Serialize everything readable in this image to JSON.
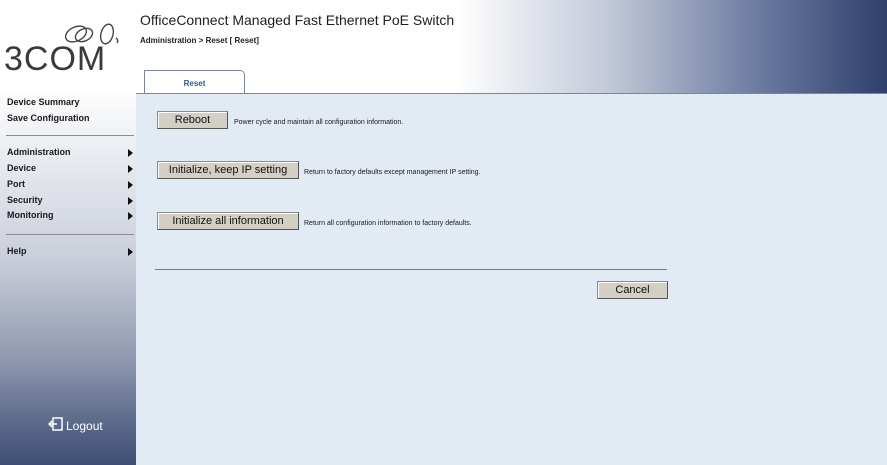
{
  "brand": {
    "logo_text": "3COM"
  },
  "header": {
    "title": "OfficeConnect Managed Fast Ethernet PoE Switch",
    "breadcrumb": "Administration > Reset [ Reset]",
    "tab_label": "Reset"
  },
  "sidebar": {
    "links": [
      "Device Summary",
      "Save Configuration"
    ],
    "menu": [
      {
        "label": "Administration"
      },
      {
        "label": "Device"
      },
      {
        "label": "Port"
      },
      {
        "label": "Security"
      },
      {
        "label": "Monitoring"
      }
    ],
    "help": "Help",
    "logout": "Logout"
  },
  "actions": [
    {
      "button": "Reboot",
      "description": "Power cycle and maintain all configuration information."
    },
    {
      "button": "Initialize, keep IP setting",
      "description": "Return to factory defaults except management IP setting."
    },
    {
      "button": "Initialize all information",
      "description": "Return all configuration information to factory defaults."
    }
  ],
  "cancel_label": "Cancel",
  "colors": {
    "content_bg": "#e2eaf4",
    "header_dark": "#2e3f6b",
    "tab_text": "#2a5a9a",
    "button_bg": "#d4cfc5"
  }
}
